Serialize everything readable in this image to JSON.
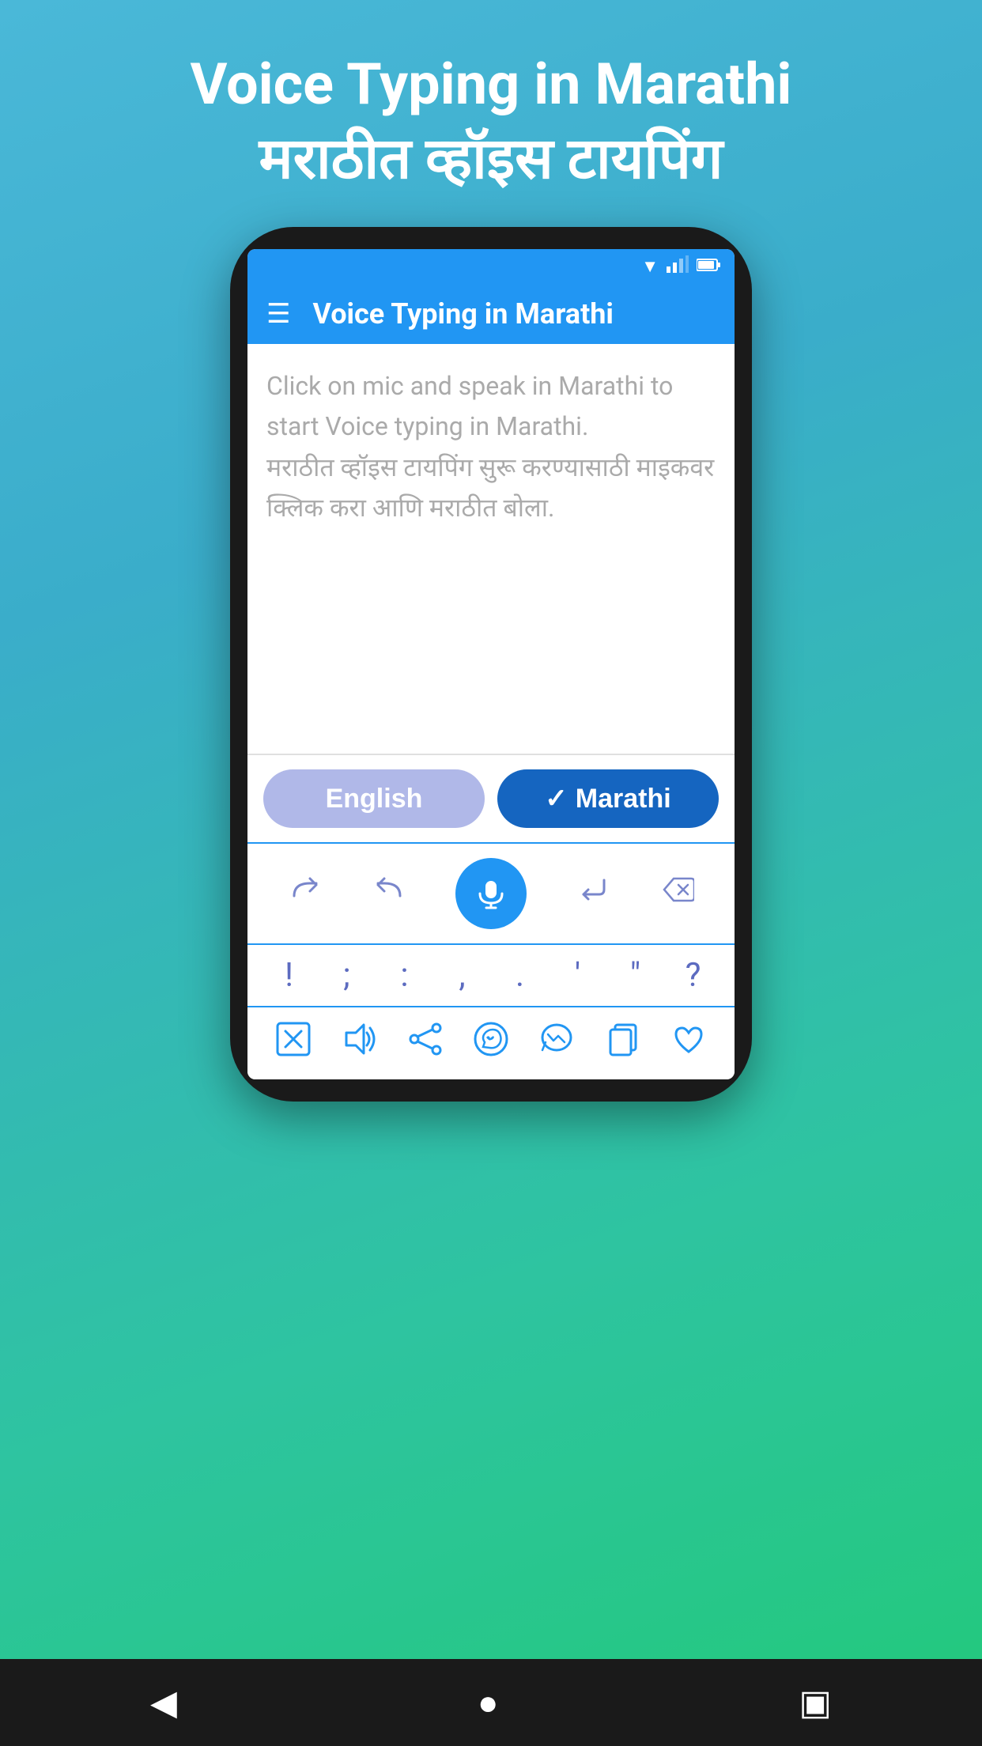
{
  "page": {
    "bg_gradient_start": "#4ab8d8",
    "bg_gradient_end": "#22c97a"
  },
  "header": {
    "title_line1": "Voice Typing in Marathi",
    "title_line2": "मराठीत व्हॉइस टायपिंग"
  },
  "app_bar": {
    "title": "Voice Typing in Marathi",
    "menu_icon": "hamburger"
  },
  "text_area": {
    "placeholder_en": "Click on mic and speak in Marathi to start Voice typing in Marathi.",
    "placeholder_mr": "मराठीत व्हॉइस टायपिंग सुरू करण्यासाठी माइकवर क्लिक करा आणि मराठीत बोला."
  },
  "language_buttons": {
    "english_label": "English",
    "marathi_label": "Marathi",
    "marathi_selected": true
  },
  "action_icons": [
    {
      "name": "redo-icon",
      "symbol": "↷"
    },
    {
      "name": "undo-icon",
      "symbol": "↶"
    },
    {
      "name": "mic-button",
      "symbol": "🎤"
    },
    {
      "name": "enter-icon",
      "symbol": "↵"
    },
    {
      "name": "backspace-icon",
      "symbol": "⌫"
    }
  ],
  "punctuation_keys": [
    "!",
    ";",
    ":",
    ",",
    ".",
    "'",
    "\"",
    "?"
  ],
  "bottom_action_icons": [
    {
      "name": "clear-icon",
      "label": "clear"
    },
    {
      "name": "speaker-icon",
      "label": "speaker"
    },
    {
      "name": "share-icon",
      "label": "share"
    },
    {
      "name": "whatsapp-icon",
      "label": "whatsapp"
    },
    {
      "name": "messenger-icon",
      "label": "messenger"
    },
    {
      "name": "copy-icon",
      "label": "copy"
    },
    {
      "name": "favorite-icon",
      "label": "favorite"
    }
  ],
  "nav": {
    "back_icon": "◀",
    "home_icon": "●",
    "recents_icon": "■"
  },
  "status_bar": {
    "wifi": "▼",
    "signal": "▲",
    "battery": "▮"
  }
}
